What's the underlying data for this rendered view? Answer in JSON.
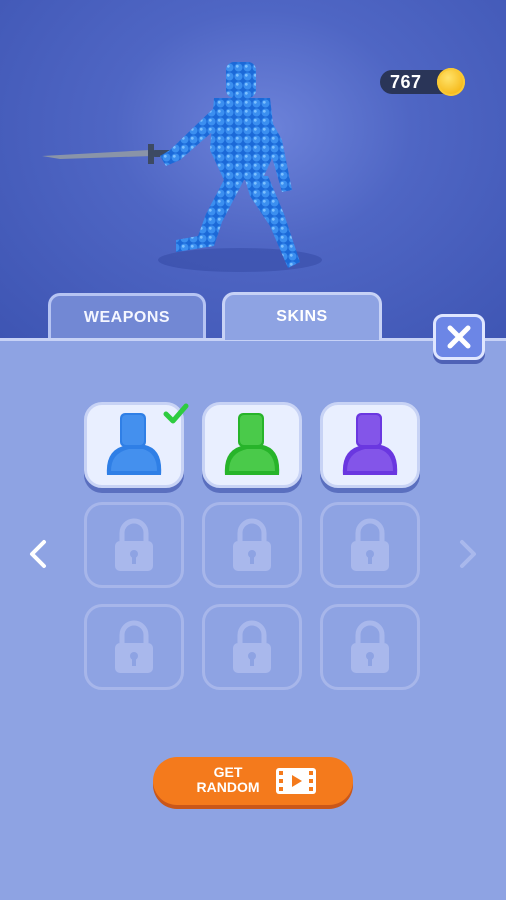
{
  "currency": {
    "coins": "767",
    "coin_icon": "gold-coin-icon"
  },
  "tabs": [
    {
      "label": "WEAPONS",
      "active": false
    },
    {
      "label": "SKINS",
      "active": true
    }
  ],
  "close_icon": "close-x-icon",
  "nav": {
    "prev_icon": "chevron-left-icon",
    "next_icon": "chevron-right-icon",
    "next_enabled": false
  },
  "skins": [
    {
      "color": "#2f7fe6",
      "selected": true,
      "locked": false
    },
    {
      "color": "#27b42a",
      "selected": false,
      "locked": false
    },
    {
      "color": "#6a37e0",
      "selected": false,
      "locked": false
    },
    {
      "locked": true
    },
    {
      "locked": true
    },
    {
      "locked": true
    },
    {
      "locked": true
    },
    {
      "locked": true
    },
    {
      "locked": true
    }
  ],
  "get_random": {
    "line1": "GET",
    "line2": "RANDOM",
    "icon": "video-ad-icon"
  },
  "colors": {
    "accent_orange": "#f47a1c",
    "check_green": "#2ecc40",
    "panel_blue": "#8ea3e3"
  }
}
